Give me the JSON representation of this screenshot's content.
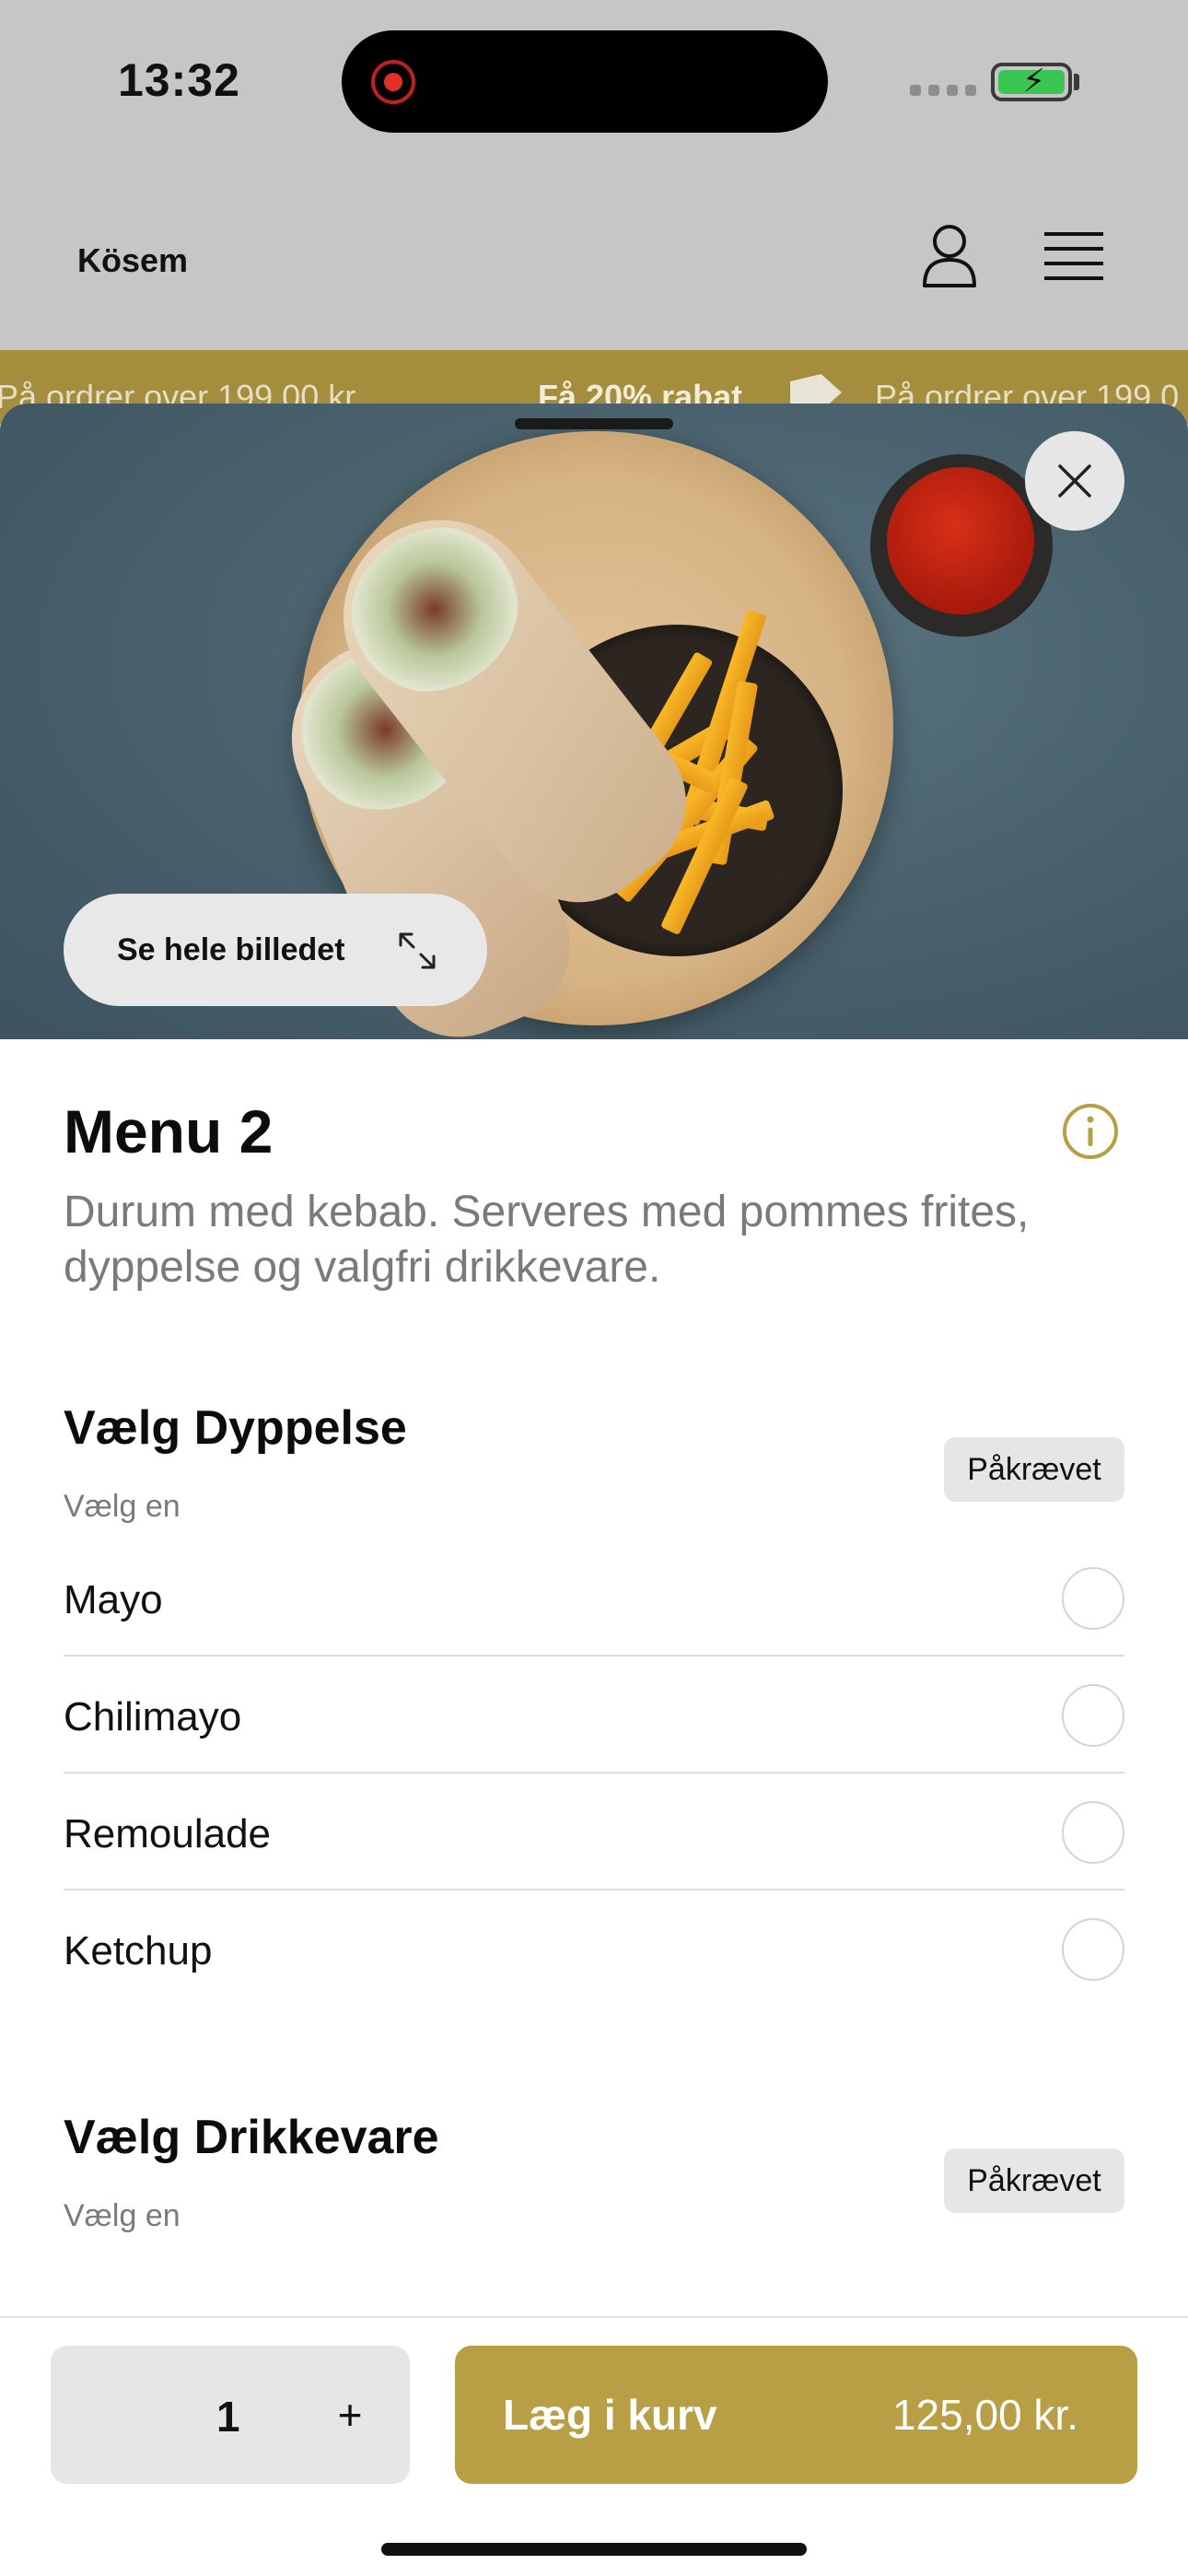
{
  "status_bar": {
    "time": "13:32"
  },
  "header": {
    "brand": "Kösem"
  },
  "promo": {
    "left_text": "På ordrer over 199,00 kr.",
    "highlight": "Få 20% rabat",
    "right_text": "På ordrer over 199,0"
  },
  "hero": {
    "see_image_label": "Se hele billedet"
  },
  "product": {
    "title": "Menu 2",
    "description": "Durum med kebab. Serveres med pommes frites, dyppelse og valgfri drikkevare."
  },
  "sections": [
    {
      "title": "Vælg Dyppelse",
      "subtitle": "Vælg en",
      "badge": "Påkrævet",
      "options": [
        "Mayo",
        "Chilimayo",
        "Remoulade",
        "Ketchup"
      ]
    },
    {
      "title": "Vælg Drikkevare",
      "subtitle": "Vælg en",
      "badge": "Påkrævet"
    }
  ],
  "cart": {
    "quantity": "1",
    "plus": "+",
    "add_label": "Læg i kurv",
    "price": "125,00 kr."
  },
  "colors": {
    "accent": "#b89f46",
    "promo_band": "#a48e3e"
  }
}
